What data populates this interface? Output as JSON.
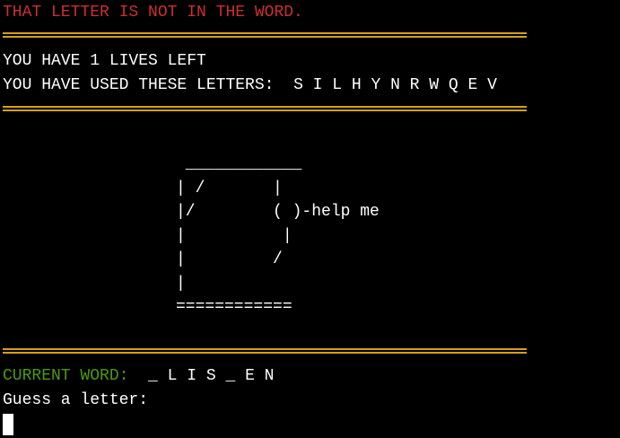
{
  "messages": {
    "error": "THAT LETTER IS NOT IN THE WORD."
  },
  "status": {
    "lives_label": "YOU HAVE 1 LIVES LEFT",
    "used_label": "YOU HAVE USED THESE LETTERS:",
    "used_letters": "S I L H Y N R W Q E V"
  },
  "hangman": {
    "art": " ____________\n| /       |\n|/        ( )-help me\n|          |\n|         /\n|\n============"
  },
  "word": {
    "label": "CURRENT WORD:",
    "value": "_ L I S _ E N"
  },
  "prompt": {
    "text": "Guess a letter:"
  },
  "colors": {
    "background": "#000000",
    "error": "#cd2f2f",
    "divider": "#d4a017",
    "label": "#4e9a06",
    "text": "#ffffff"
  }
}
